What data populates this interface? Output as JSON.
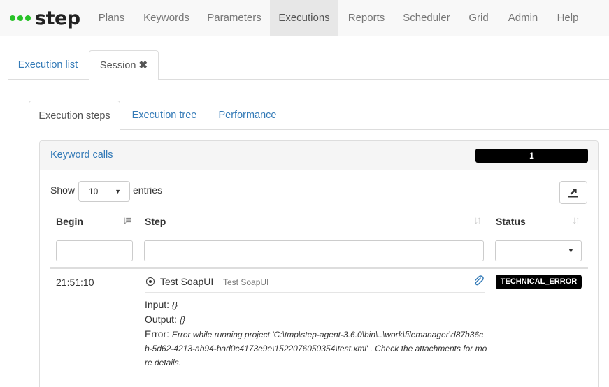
{
  "brand": {
    "name": "step",
    "accent": "#28c228"
  },
  "nav": [
    {
      "label": "Plans"
    },
    {
      "label": "Keywords"
    },
    {
      "label": "Parameters"
    },
    {
      "label": "Executions"
    },
    {
      "label": "Reports"
    },
    {
      "label": "Scheduler"
    },
    {
      "label": "Grid"
    },
    {
      "label": "Admin"
    },
    {
      "label": "Help"
    }
  ],
  "session_tabs": {
    "list": "Execution list",
    "session": "Session",
    "close_icon": "times-icon"
  },
  "exec_tabs": {
    "steps": "Execution steps",
    "tree": "Execution tree",
    "performance": "Performance"
  },
  "panel": {
    "title": "Keyword calls",
    "count": "1",
    "show": "Show",
    "entries_value": "10",
    "entries": "entries",
    "export_icon": "export-icon"
  },
  "table": {
    "columns": {
      "begin": "Begin",
      "step": "Step",
      "status": "Status"
    },
    "rows": [
      {
        "begin": "21:51:10",
        "step_name": "Test SoapUI",
        "step_sub": "Test SoapUI",
        "input_label": "Input:",
        "input_value": "{}",
        "output_label": "Output:",
        "output_value": "{}",
        "error_label": "Error:",
        "error_line1": "Error while running project 'C:\\tmp\\step-agent-3.6.0\\bin\\..\\work\\filemanager\\d87b36c",
        "error_line2": "b-5d62-4213-ab94-bad0c4173e9e\\1522076050354\\test.xml' . Check the attachments for mo",
        "error_line3": "re details.",
        "status": "TECHNICAL_ERROR"
      }
    ]
  }
}
